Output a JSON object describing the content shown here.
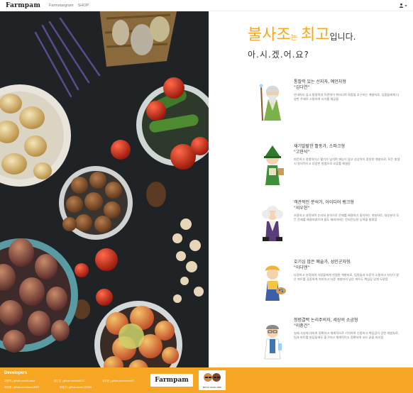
{
  "nav": {
    "brand": "Farmpam",
    "links": [
      "Farmstargram",
      "SHOP"
    ],
    "user_icon": "user-icon",
    "caret_icon": "caret-down-icon"
  },
  "hero": {
    "word1": "불사조",
    "particle": "는",
    "word2": "최고",
    "ending": "입니다.",
    "line2": "아.시.겠.어.요?",
    "accent_color": "#f5a623"
  },
  "characters": [
    {
      "title": "통찰력 있는 선지자, 예언자형",
      "name": "\"김다연\"",
      "desc": "안내하지 않고 통찰력과 직관력이 뛰어나며 화합을 추구하는 개발자로, 입환들에게 다양한 주제로 소통하며 시기를 제공을"
    },
    {
      "title": "재기발랄한 활동가, 스파크형",
      "name": "\"고현석\"",
      "desc": "따뜻하고 정열적이고 활기가 넘치며 재능이 많고 상상력이 풍부한 개발자로, 모든 발생시 창의적이고 다양한 방법으로 오류를 해결함"
    },
    {
      "title": "객관적인 분석가, 아이디어 뱅크형",
      "name": "\"서우현\"",
      "desc": "조용하고 과묵하며 논리와 분석으로 문제를 해결하기 좋아하는 개발자로, 대부분의 모든 문제를 해결하였으며 둘도 제외하여는 전지전능한 능력을 발휘함"
    },
    {
      "title": "호기심 많은 예술가, 성인군자형",
      "name": "\"이다엔\"",
      "desc": "다정하고 온화하여 사람들에게 친절한 개발자로, 팀원들과 오준이 소통하고 자신이 맡은 파트를 꼼꼼하게 처리하고 다른 개발자의 남은 파트도 책임감 있게 도맡음"
    },
    {
      "title": "청렴결백 논리주의자, 세상의 소금형",
      "name": "\"이충건\"",
      "desc": "실제 사실에 대하여 정확하고 체계적으로 기억하며 신중하고 책임감이 강한 개발자로, 팀과 파트를 분담들에도 좋구하고 체계적이고 정확하게 코드 끝을 처리함"
    }
  ],
  "footer": {
    "title": "Developers",
    "devs": [
      "고현석 | github.com/fo-kaka",
      "김다연 | github.com/kd6012",
      "서우현 | github.com/ssoeh07",
      "이다엔 | github.com/daenu1207",
      "이충건 | github.com/LCG989"
    ],
    "logo": "Farmpam",
    "badge": "BRIGHT DEVELOPER"
  }
}
